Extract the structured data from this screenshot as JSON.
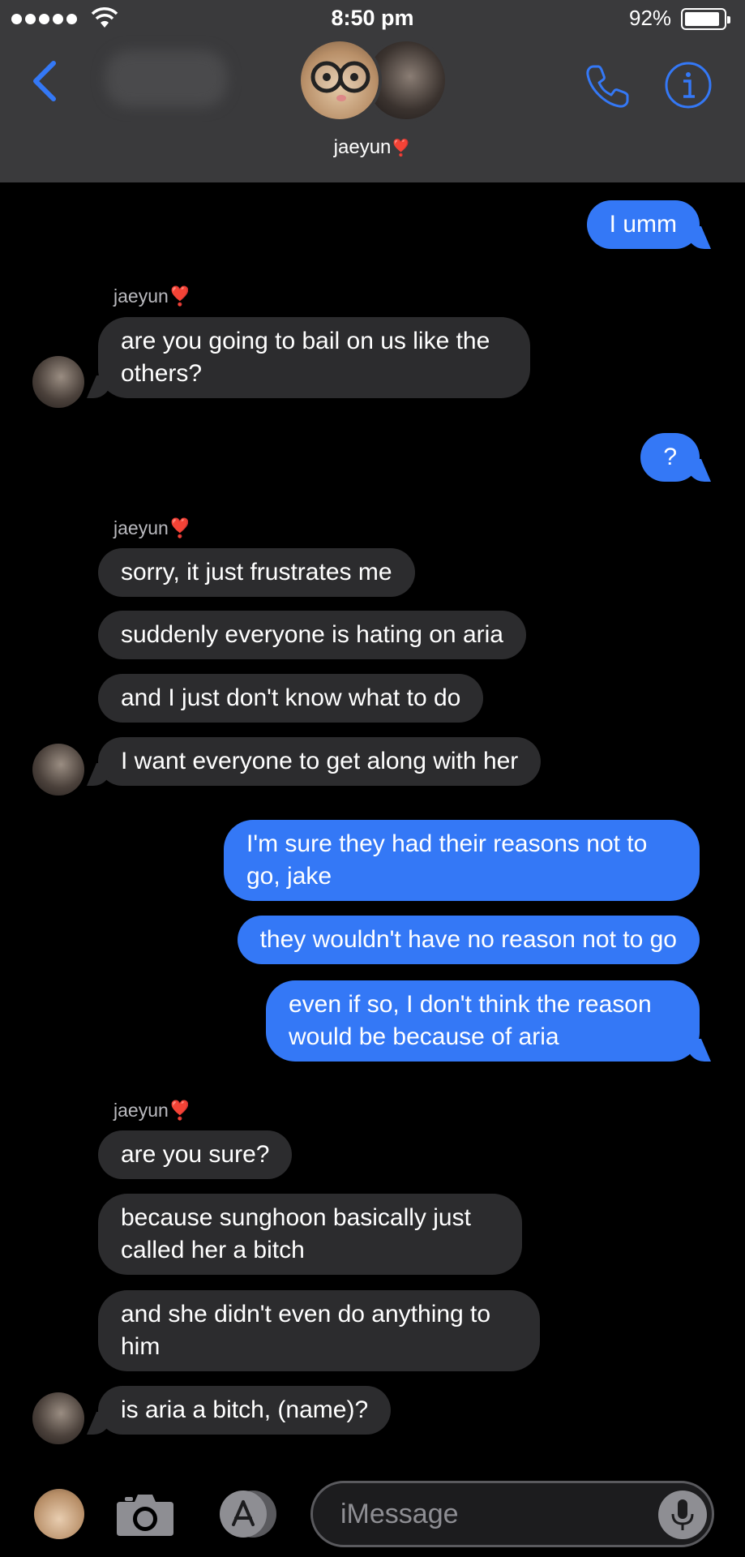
{
  "status_bar": {
    "time": "8:50 pm",
    "battery_percent": "92%",
    "battery_level": 0.92
  },
  "header": {
    "contact_name": "jaeyun",
    "heart": "❣️"
  },
  "messages": [
    {
      "dir": "out",
      "lines": [
        "I umm"
      ]
    },
    {
      "sender": "jaeyun❣️"
    },
    {
      "dir": "in",
      "lines": [
        "are you going to bail on us like the",
        "others?"
      ]
    },
    {
      "dir": "out",
      "lines": [
        "?"
      ]
    },
    {
      "sender": "jaeyun❣️"
    },
    {
      "dir": "in",
      "lines": [
        "sorry, it just frustrates me"
      ]
    },
    {
      "dir": "in",
      "lines": [
        "suddenly everyone is hating on aria"
      ]
    },
    {
      "dir": "in",
      "lines": [
        "and I just don't know what to do"
      ]
    },
    {
      "dir": "in",
      "lines": [
        "I want everyone to get along with her"
      ]
    },
    {
      "dir": "out",
      "lines": [
        "I'm sure they had their reasons not to",
        "go, jake"
      ]
    },
    {
      "dir": "out",
      "lines": [
        "they wouldn't have no reason not to go"
      ]
    },
    {
      "dir": "out",
      "lines": [
        "even if so, I don't think the reason",
        "would be because of aria"
      ]
    },
    {
      "sender": "jaeyun❣️"
    },
    {
      "dir": "in",
      "lines": [
        "are you sure?"
      ]
    },
    {
      "dir": "in",
      "lines": [
        "because sunghoon basically just",
        "called her a bitch"
      ]
    },
    {
      "dir": "in",
      "lines": [
        "and she didn't even do anything to",
        "him"
      ]
    },
    {
      "dir": "in",
      "lines": [
        "is aria a bitch, (name)?"
      ]
    }
  ],
  "input": {
    "placeholder": "iMessage",
    "value": ""
  },
  "icons": {
    "back": "chevron-left-icon",
    "phone": "phone-icon",
    "info": "info-icon",
    "camera": "camera-icon",
    "apps": "app-store-icon",
    "mic": "microphone-icon"
  },
  "colors": {
    "outgoing_bubble": "#3478f6",
    "incoming_bubble": "#2c2c2e",
    "accent": "#3478f6",
    "header_bg": "#3a3a3c",
    "background": "#000000"
  }
}
